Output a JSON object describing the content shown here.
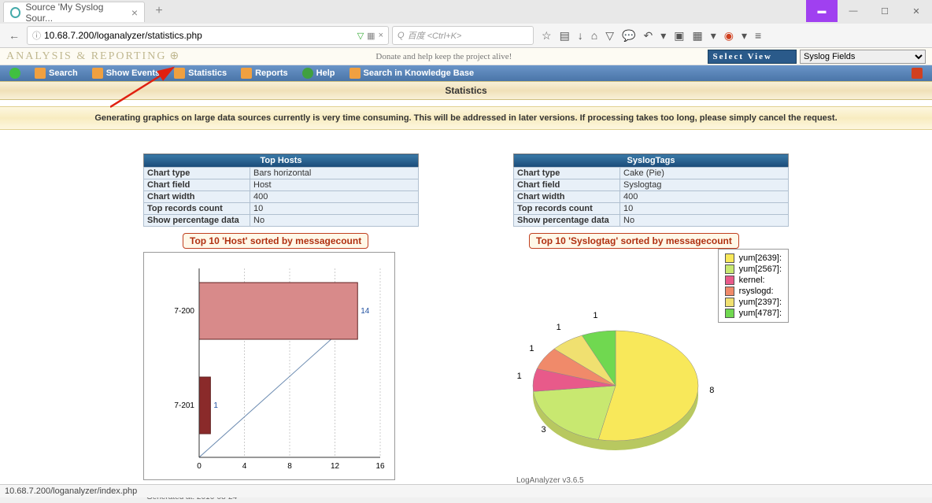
{
  "browser": {
    "tab_title": "Source 'My Syslog Sour...",
    "url": "10.68.7.200/loganalyzer/statistics.php",
    "search_placeholder": "百度 <Ctrl+K>",
    "status": "10.68.7.200/loganalyzer/index.php"
  },
  "page": {
    "brand": "ANALYSIS & REPORTING",
    "donate": "Donate and help keep the project alive!",
    "select_view_label": "Select View",
    "select_view_value": "Syslog Fields",
    "menu": {
      "search": "Search",
      "show_events": "Show Events",
      "statistics": "Statistics",
      "reports": "Reports",
      "help": "Help",
      "kb": "Search in Knowledge Base"
    },
    "section_title": "Statistics",
    "notice": "Generating graphics on large data sources currently is very time consuming. This will be addressed in later versions. If processing takes too long, please simply cancel the request."
  },
  "chart_data": [
    {
      "type": "bar",
      "orientation": "horizontal",
      "panel_title": "Top Hosts",
      "meta": {
        "chart_type": "Bars horizontal",
        "chart_field": "Host",
        "chart_width": "400",
        "top_records": "10",
        "show_pct": "No"
      },
      "title": "Top 10 'Host' sorted by messagecount",
      "categories": [
        "7-200",
        "7-201"
      ],
      "values": [
        14,
        1
      ],
      "x_ticks": [
        0,
        4,
        8,
        12,
        16
      ],
      "footer": "LogAnalyzer v3.6.5",
      "generated": "Generated at: 2016-08-24"
    },
    {
      "type": "pie",
      "panel_title": "SyslogTags",
      "meta": {
        "chart_type": "Cake (Pie)",
        "chart_field": "Syslogtag",
        "chart_width": "400",
        "top_records": "10",
        "show_pct": "No"
      },
      "title": "Top 10 'Syslogtag' sorted by messagecount",
      "series": [
        {
          "name": "yum[2639]:",
          "value": 8,
          "color": "#f8e85a"
        },
        {
          "name": "yum[2567]:",
          "value": 3,
          "color": "#c8e870"
        },
        {
          "name": "kernel:",
          "value": 1,
          "color": "#e85a8a"
        },
        {
          "name": "rsyslogd:",
          "value": 1,
          "color": "#f08a6a"
        },
        {
          "name": "yum[2397]:",
          "value": 1,
          "color": "#f0e070"
        },
        {
          "name": "yum[4787]:",
          "value": 1,
          "color": "#70d850"
        }
      ],
      "footer": "LogAnalyzer v3.6.5",
      "generated": "Generated at: 2016-08-24"
    }
  ],
  "meta_labels": {
    "chart_type": "Chart type",
    "chart_field": "Chart field",
    "chart_width": "Chart width",
    "top_records": "Top records count",
    "show_pct": "Show percentage data"
  }
}
